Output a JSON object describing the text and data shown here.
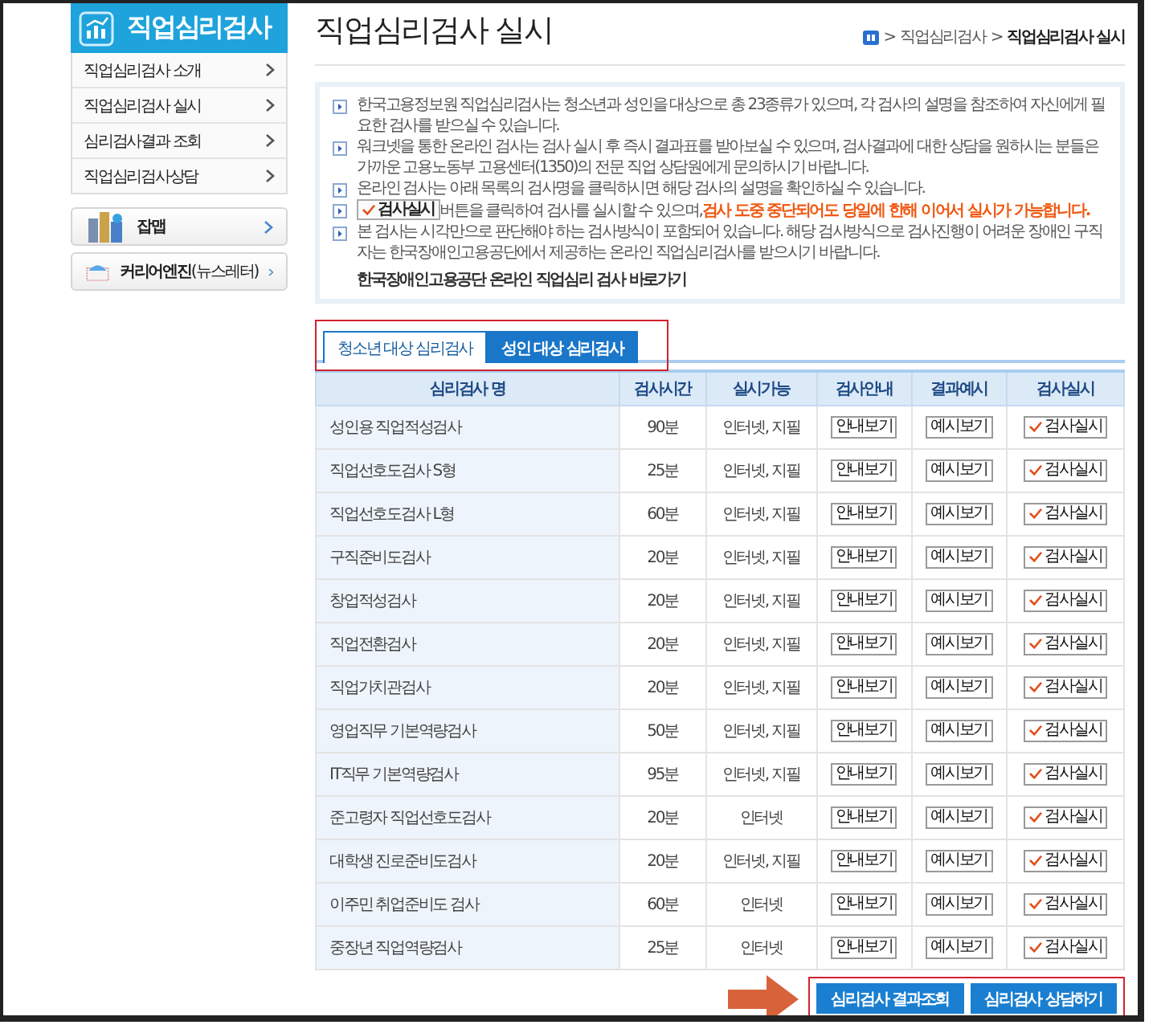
{
  "sidebar": {
    "title": "직업심리검사",
    "menu": [
      {
        "label": "직업심리검사 소개"
      },
      {
        "label": "직업심리검사 실시"
      },
      {
        "label": "심리검사결과 조회"
      },
      {
        "label": "직업심리검사상담"
      }
    ],
    "cards": [
      {
        "kind": "map",
        "label": "잡맵"
      },
      {
        "kind": "mail",
        "label": "커리어엔진",
        "sub": "(뉴스레터)"
      }
    ]
  },
  "page": {
    "title": "직업심리검사 실시",
    "breadcrumb": {
      "separator": ">",
      "items": [
        "직업심리검사",
        "직업심리검사 실시"
      ]
    }
  },
  "notice": {
    "items": [
      {
        "text": "한국고용정보원 직업심리검사는 청소년과 성인을 대상으로 총 23종류가 있으며, 각 검사의 설명을 참조하여 자신에게 필요한 검사를 받으실 수 있습니다."
      },
      {
        "text": "워크넷을 통한 온라인 검사는 검사 실시 후 즉시 결과표를 받아보실 수 있으며, 검사결과에 대한 상담을 원하시는 분들은 가까운 고용노동부 고용센터(1350)의 전문 직업 상담원에게 문의하시기 바랍니다."
      },
      {
        "text": "온라인 검사는 아래 목록의 검사명을 클릭하시면 해당 검사의 설명을 확인하실 수 있습니다."
      },
      {
        "button": "검사실시",
        "text": "버튼을 클릭하여 검사를 실시할 수 있으며,",
        "highlight": "검사 도중 중단되어도 당일에 한해 이어서 실시가 가능합니다."
      },
      {
        "text": "본 검사는 시각만으로 판단해야 하는 검사방식이 포함되어 있습니다. 해당 검사방식으로 검사진행이 어려운 장애인 구직자는 한국장애인고용공단에서 제공하는 온라인 직업심리검사를 받으시기 바랍니다."
      }
    ],
    "link": "한국장애인고용공단 온라인 직업심리 검사 바로가기"
  },
  "tabs": [
    {
      "label": "청소년 대상 심리검사",
      "selected": false
    },
    {
      "label": "성인 대상 심리검사",
      "selected": true
    }
  ],
  "table": {
    "columns": [
      "심리검사 명",
      "검사시간",
      "실시가능",
      "검사안내",
      "결과예시",
      "검사실시"
    ],
    "rows": [
      {
        "name": "성인용 직업적성검사",
        "time": "90분",
        "mode": "인터넷, 지필",
        "guide": "안내보기",
        "example": "예시보기",
        "start": "검사실시"
      },
      {
        "name": "직업선호도검사 S형",
        "time": "25분",
        "mode": "인터넷, 지필",
        "guide": "안내보기",
        "example": "예시보기",
        "start": "검사실시"
      },
      {
        "name": "직업선호도검사 L형",
        "time": "60분",
        "mode": "인터넷, 지필",
        "guide": "안내보기",
        "example": "예시보기",
        "start": "검사실시"
      },
      {
        "name": "구직준비도검사",
        "time": "20분",
        "mode": "인터넷, 지필",
        "guide": "안내보기",
        "example": "예시보기",
        "start": "검사실시"
      },
      {
        "name": "창업적성검사",
        "time": "20분",
        "mode": "인터넷, 지필",
        "guide": "안내보기",
        "example": "예시보기",
        "start": "검사실시"
      },
      {
        "name": "직업전환검사",
        "time": "20분",
        "mode": "인터넷, 지필",
        "guide": "안내보기",
        "example": "예시보기",
        "start": "검사실시"
      },
      {
        "name": "직업가치관검사",
        "time": "20분",
        "mode": "인터넷, 지필",
        "guide": "안내보기",
        "example": "예시보기",
        "start": "검사실시"
      },
      {
        "name": "영업직무 기본역량검사",
        "time": "50분",
        "mode": "인터넷, 지필",
        "guide": "안내보기",
        "example": "예시보기",
        "start": "검사실시"
      },
      {
        "name": "IT직무 기본역량검사",
        "time": "95분",
        "mode": "인터넷, 지필",
        "guide": "안내보기",
        "example": "예시보기",
        "start": "검사실시"
      },
      {
        "name": "준고령자 직업선호도검사",
        "time": "20분",
        "mode": "인터넷",
        "guide": "안내보기",
        "example": "예시보기",
        "start": "검사실시"
      },
      {
        "name": "대학생 진로준비도검사",
        "time": "20분",
        "mode": "인터넷, 지필",
        "guide": "안내보기",
        "example": "예시보기",
        "start": "검사실시"
      },
      {
        "name": "이주민 취업준비도 검사",
        "time": "60분",
        "mode": "인터넷",
        "guide": "안내보기",
        "example": "예시보기",
        "start": "검사실시"
      },
      {
        "name": "중장년 직업역량검사",
        "time": "25분",
        "mode": "인터넷",
        "guide": "안내보기",
        "example": "예시보기",
        "start": "검사실시"
      }
    ]
  },
  "actions": [
    "심리검사 결과조회",
    "심리검사 상담하기"
  ]
}
